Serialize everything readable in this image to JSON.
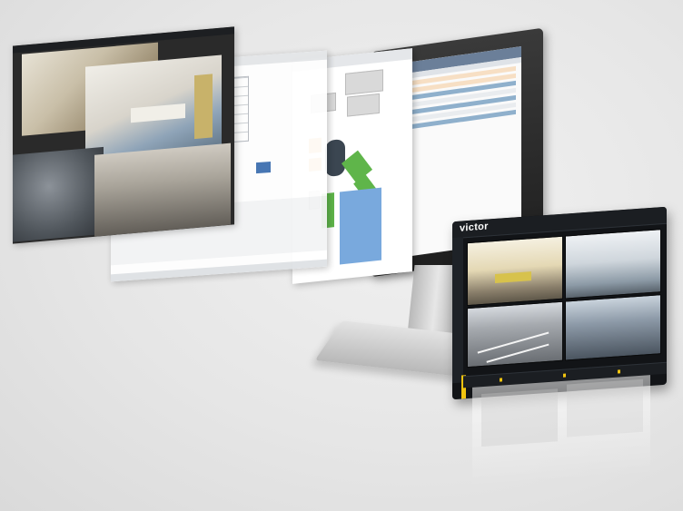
{
  "scene": {
    "background": "#e6e6e6"
  },
  "tablet": {
    "logo": "victor",
    "accent": "#f1c40f",
    "theme": "#121417"
  },
  "monitor": {
    "bezel": "#1f1f1f",
    "stand": "#bdbdbd"
  },
  "panes": {
    "photo_collage": {
      "accent": "#2a2a2a"
    },
    "table_view": {
      "accent": "#3d6fb0"
    },
    "map_view": {
      "orange": "#f0a033",
      "green": "#5fb54a",
      "blue": "#79a9dd"
    }
  }
}
